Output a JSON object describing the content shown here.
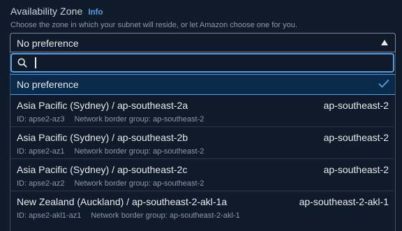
{
  "field": {
    "label": "Availability Zone",
    "info_link": "Info",
    "description": "Choose the zone in which your subnet will reside, or let Amazon choose one for you."
  },
  "select": {
    "value": "No preference",
    "caret_icon": "caret-up-icon"
  },
  "search": {
    "placeholder": "",
    "value": "",
    "icon": "search-icon"
  },
  "options": [
    {
      "label": "No preference",
      "selected": true,
      "check_icon": "check-icon"
    },
    {
      "label": "Asia Pacific (Sydney) / ap-southeast-2a",
      "tag": "ap-southeast-2",
      "id": "ID: apse2-az3",
      "group": "Network border group: ap-southeast-2"
    },
    {
      "label": "Asia Pacific (Sydney) / ap-southeast-2b",
      "tag": "ap-southeast-2",
      "id": "ID: apse2-az1",
      "group": "Network border group: ap-southeast-2"
    },
    {
      "label": "Asia Pacific (Sydney) / ap-southeast-2c",
      "tag": "ap-southeast-2",
      "id": "ID: apse2-az2",
      "group": "Network border group: ap-southeast-2"
    },
    {
      "label": "New Zealand (Auckland) / ap-southeast-2-akl-1a",
      "tag": "ap-southeast-2-akl-1",
      "id": "ID: apse2-akl1-az1",
      "group": "Network border group: ap-southeast-2-akl-1"
    }
  ],
  "colors": {
    "background": "#0f1b2a",
    "accent": "#539fe5",
    "text_primary": "#e9ebed",
    "text_secondary": "#8d99a8",
    "selected_bg": "#0a2a4a"
  }
}
